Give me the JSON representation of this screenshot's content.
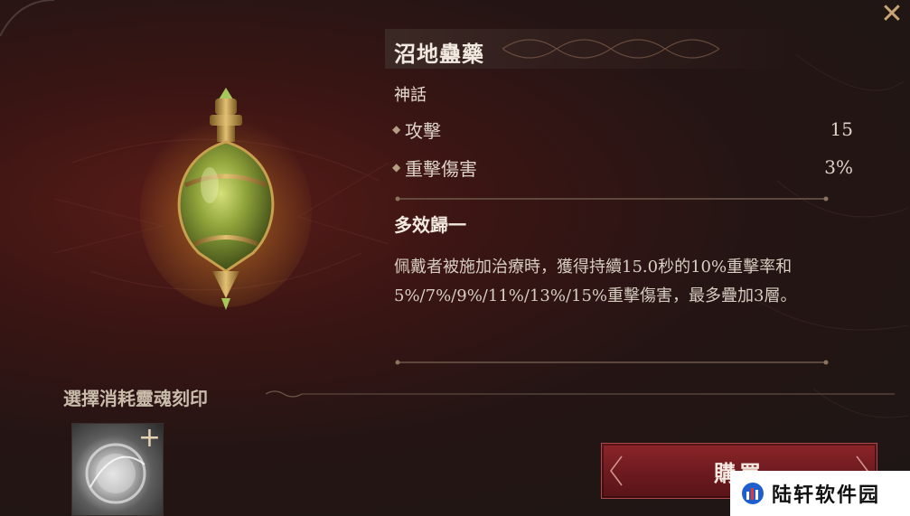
{
  "item": {
    "name": "沼地蠱藥",
    "rarity": "神話",
    "stats": [
      {
        "label": "攻擊",
        "value": "15"
      },
      {
        "label": "重擊傷害",
        "value": "3%"
      }
    ],
    "effect_title": "多效歸一",
    "effect_description": "佩戴者被施加治療時，獲得持續15.0秒的10%重擊率和5%/7%/9%/11%/13%/15%重擊傷害，最多疊加3層。",
    "icon": "green-potion-flask-icon"
  },
  "engrave": {
    "title": "選擇消耗靈魂刻印",
    "slot_icon": "soul-engraving-orb-icon",
    "add_symbol": "+"
  },
  "actions": {
    "buy_label": "購買",
    "close_symbol": "✕"
  },
  "watermark": {
    "text": "陆轩软件园"
  },
  "colors": {
    "accent_red": "#7a1d22",
    "gold": "#c9a572",
    "text": "#e7ddd1"
  }
}
